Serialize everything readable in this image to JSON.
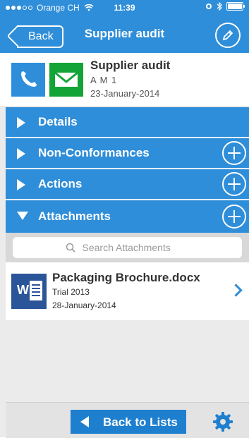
{
  "status_bar": {
    "carrier": "Orange CH",
    "time": "11:39"
  },
  "nav": {
    "back_label": "Back",
    "title": "Supplier audit"
  },
  "header": {
    "title": "Supplier audit",
    "subtitle": "A M 1",
    "date": "23-January-2014"
  },
  "sections": [
    {
      "label": "Details"
    },
    {
      "label": "Non-Conformances"
    },
    {
      "label": "Actions"
    },
    {
      "label": "Attachments"
    }
  ],
  "search": {
    "placeholder": "Search Attachments"
  },
  "attachments": [
    {
      "name": "Packaging Brochure.docx",
      "group": "Trial 2013",
      "date": "28-January-2014"
    }
  ],
  "bottom": {
    "back_to_lists": "Back to Lists"
  },
  "colors": {
    "accent": "#2f8ed9",
    "mail_green": "#12a436",
    "word_blue": "#2a5699"
  },
  "icons": [
    "phone-icon",
    "mail-icon",
    "edit-icon",
    "plus-icon",
    "search-icon",
    "word-doc-icon",
    "chevron-right-icon",
    "gear-icon"
  ]
}
